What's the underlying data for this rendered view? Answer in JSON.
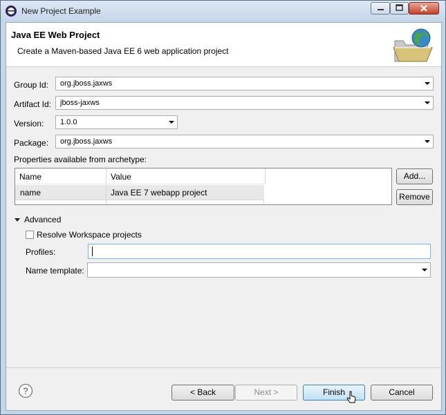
{
  "window": {
    "title": "New Project Example",
    "controls": [
      "minimize-icon",
      "maximize-icon",
      "close-icon"
    ]
  },
  "banner": {
    "title": "Java EE Web Project",
    "description": "Create a Maven-based Java EE 6 web application project",
    "icon": "folder-globe-icon"
  },
  "form": {
    "group_id": {
      "label": "Group Id:",
      "value": "org.jboss.jaxws"
    },
    "artifact_id": {
      "label": "Artifact Id:",
      "value": "jboss-jaxws"
    },
    "version": {
      "label": "Version:",
      "value": "1.0.0"
    },
    "package": {
      "label": "Package:",
      "value": "org.jboss.jaxws"
    }
  },
  "properties": {
    "label": "Properties available from archetype:",
    "columns": [
      "Name",
      "Value"
    ],
    "rows": [
      {
        "name": "name",
        "value": "Java EE 7 webapp project"
      }
    ],
    "add_label": "Add...",
    "remove_label": "Remove"
  },
  "advanced": {
    "label": "Advanced",
    "resolve_label": "Resolve Workspace projects",
    "resolve_checked": false,
    "profiles_label": "Profiles:",
    "profiles_value": "",
    "name_template_label": "Name template:",
    "name_template_value": ""
  },
  "footer": {
    "help_icon": "help-icon",
    "back_label": "< Back",
    "next_label": "Next >",
    "finish_label": "Finish",
    "cancel_label": "Cancel"
  }
}
